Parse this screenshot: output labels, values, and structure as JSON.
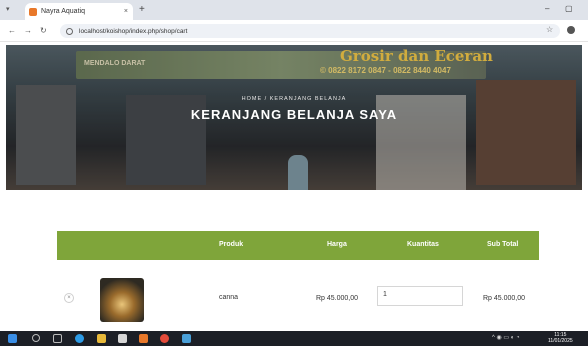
{
  "browser": {
    "tab_title": "Nayra Aquatiq",
    "tab_close": "×",
    "new_tab": "+",
    "url": "localhost/koishop/index.php/shop/cart",
    "icons": [
      "tab-menu-icon",
      "back-icon",
      "forward-icon",
      "reload-icon",
      "site-info-icon",
      "bookmark-star-icon",
      "profile-icon",
      "minimize-icon",
      "maximize-icon"
    ]
  },
  "hero": {
    "sign_left": "MENDALO DARAT",
    "sign_brand": "Grosir dan Eceran",
    "sign_phone": "© 0822 8172 0847 - 0822 8440 4047",
    "breadcrumb": "HOME  /  KERANJANG BELANJA",
    "title": "KERANJANG BELANJA SAYA"
  },
  "cart": {
    "headers": [
      "Produk",
      "Harga",
      "Kuantitas",
      "Sub Total"
    ],
    "rows": [
      {
        "remove": "×",
        "product": "canna",
        "price": "Rp 45.000,00",
        "quantity": "1",
        "subtotal": "Rp 45.000,00"
      }
    ]
  },
  "taskbar": {
    "time": "11:15",
    "date": "11/01/2025",
    "icons": [
      "windows-start-icon",
      "search-icon",
      "task-view-icon",
      "edge-icon",
      "file-explorer-icon",
      "store-icon",
      "office-icon",
      "chrome-icon",
      "photos-icon"
    ]
  },
  "colors": {
    "accent": "#7fa53a",
    "taskbar": "#1c1f26"
  }
}
